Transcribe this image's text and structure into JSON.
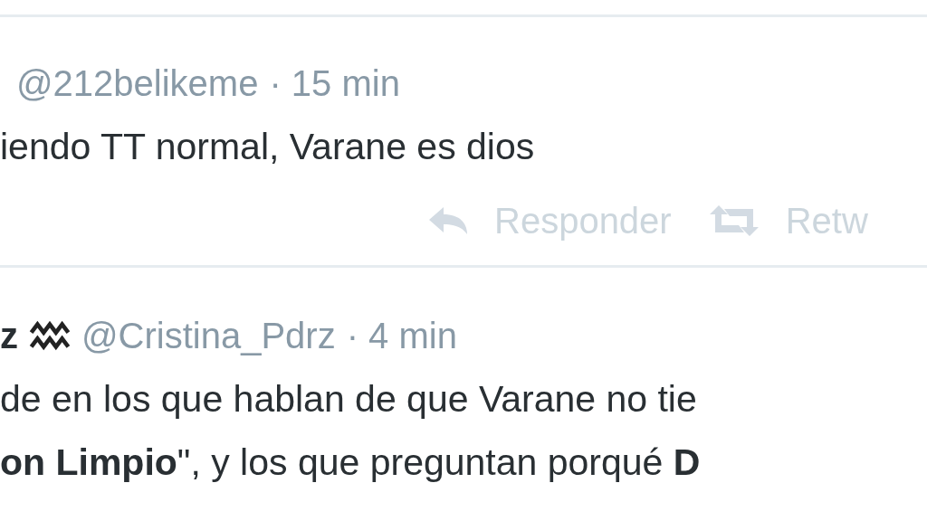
{
  "tweets": [
    {
      "handle": "@212belikeme",
      "time": "· 15 min",
      "text_lines": [
        "iendo TT normal, Varane es dios"
      ],
      "actions": [
        {
          "kind": "reply",
          "label": "Responder"
        },
        {
          "kind": "retweet",
          "label": "Retw"
        }
      ]
    },
    {
      "name": "z",
      "zodiac": true,
      "handle": "@Cristina_Pdrz",
      "time": "· 4 min",
      "text_lines": [
        "de en los que hablan de que Varane no tie",
        "**on Limpio**\", y los que preguntan porqué **D**"
      ]
    }
  ]
}
